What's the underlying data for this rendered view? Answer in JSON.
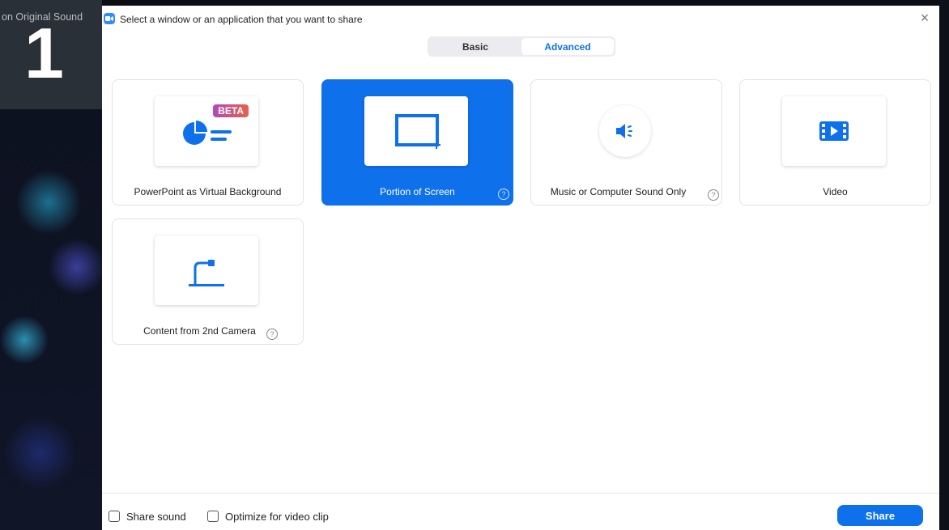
{
  "background": {
    "sound_label": "on Original Sound",
    "number": "1"
  },
  "dialog": {
    "title": "Select a window or an application that you want to share",
    "close_symbol": "×",
    "tabs": [
      {
        "label": "Basic",
        "active": false
      },
      {
        "label": "Advanced",
        "active": true
      }
    ],
    "options": [
      {
        "label": "PowerPoint as Virtual Background",
        "badge": "BETA",
        "icon": "powerpoint-icon",
        "selected": false,
        "help": false
      },
      {
        "label": "Portion of Screen",
        "icon": "screen-portion-icon",
        "selected": true,
        "help": true
      },
      {
        "label": "Music or Computer Sound Only",
        "icon": "speaker-icon",
        "selected": false,
        "help": true
      },
      {
        "label": "Video",
        "icon": "video-icon",
        "selected": false,
        "help": false
      },
      {
        "label": "Content from 2nd Camera",
        "icon": "camera-icon",
        "selected": false,
        "help": true
      }
    ],
    "help_symbol": "?",
    "footer": {
      "share_sound_label": "Share sound",
      "optimize_label": "Optimize for video clip",
      "share_button": "Share"
    }
  },
  "colors": {
    "accent": "#0e71eb",
    "icon_blue": "#2d8cff",
    "beta_gradient_start": "#b14ab8",
    "beta_gradient_end": "#e8604c"
  }
}
